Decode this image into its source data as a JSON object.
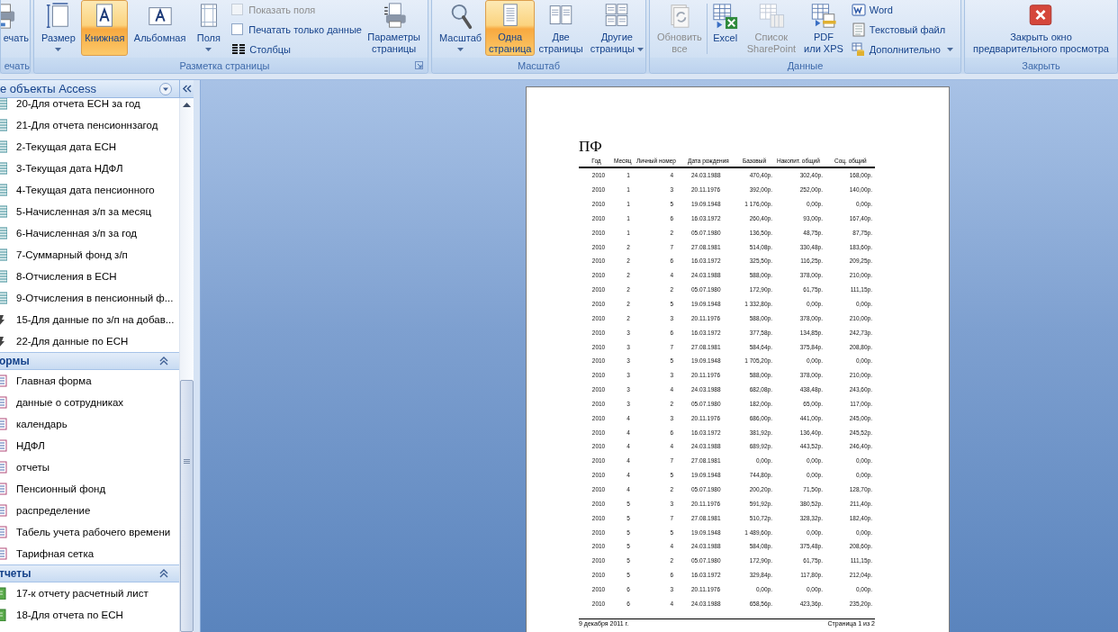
{
  "ribbon": {
    "groups": [
      {
        "label": "ечать",
        "launcher": false,
        "controls": [
          {
            "kind": "large",
            "lines": [
              "ечать"
            ],
            "selected": false,
            "disabled": false,
            "dropdown": false
          }
        ]
      },
      {
        "label": "Разметка страницы",
        "launcher": true,
        "controls": [
          {
            "kind": "large",
            "lines": [
              "Размер"
            ],
            "selected": false,
            "disabled": false,
            "dropdown": true
          },
          {
            "kind": "large",
            "lines": [
              "Книжная"
            ],
            "selected": true,
            "disabled": false,
            "dropdown": false
          },
          {
            "kind": "large",
            "lines": [
              "Альбомная"
            ],
            "selected": false,
            "disabled": false,
            "dropdown": false
          },
          {
            "kind": "large",
            "lines": [
              "Поля"
            ],
            "selected": false,
            "disabled": false,
            "dropdown": true
          },
          {
            "kind": "stack",
            "items": [
              {
                "kind": "checkbox",
                "label": "Показать поля",
                "checked": false,
                "disabled": true
              },
              {
                "kind": "checkbox",
                "label": "Печатать только данные",
                "checked": false,
                "disabled": false
              },
              {
                "kind": "small",
                "label": "Столбцы",
                "disabled": false,
                "dropdown": false
              }
            ]
          },
          {
            "kind": "large",
            "lines": [
              "Параметры",
              "страницы"
            ],
            "selected": false,
            "disabled": false,
            "dropdown": false
          }
        ]
      },
      {
        "label": "Масштаб",
        "launcher": false,
        "controls": [
          {
            "kind": "large",
            "lines": [
              "Масштаб"
            ],
            "selected": false,
            "disabled": false,
            "dropdown": true
          },
          {
            "kind": "large",
            "lines": [
              "Одна",
              "страница"
            ],
            "selected": true,
            "disabled": false,
            "dropdown": false
          },
          {
            "kind": "large",
            "lines": [
              "Две",
              "страницы"
            ],
            "selected": false,
            "disabled": false,
            "dropdown": false
          },
          {
            "kind": "large",
            "lines": [
              "Другие",
              "страницы"
            ],
            "selected": false,
            "disabled": false,
            "dropdown": true
          }
        ]
      },
      {
        "label": "Данные",
        "launcher": false,
        "controls": [
          {
            "kind": "large",
            "lines": [
              "Обновить",
              "все"
            ],
            "selected": false,
            "disabled": true,
            "dropdown": false
          },
          {
            "kind": "separator"
          },
          {
            "kind": "large",
            "lines": [
              "Excel"
            ],
            "selected": false,
            "disabled": false,
            "dropdown": false
          },
          {
            "kind": "large",
            "lines": [
              "Список",
              "SharePoint"
            ],
            "selected": false,
            "disabled": true,
            "dropdown": false
          },
          {
            "kind": "large",
            "lines": [
              "PDF",
              "или XPS"
            ],
            "selected": false,
            "disabled": false,
            "dropdown": false
          },
          {
            "kind": "stack",
            "items": [
              {
                "kind": "small",
                "label": "Word",
                "disabled": false,
                "dropdown": false
              },
              {
                "kind": "small",
                "label": "Текстовый файл",
                "disabled": false,
                "dropdown": false
              },
              {
                "kind": "small",
                "label": "Дополнительно",
                "disabled": false,
                "dropdown": true
              }
            ]
          }
        ]
      },
      {
        "label": "Закрыть",
        "launcher": false,
        "controls": [
          {
            "kind": "large",
            "lines": [
              "Закрыть окно",
              "предварительного просмотра"
            ],
            "selected": false,
            "disabled": false,
            "dropdown": false
          }
        ]
      }
    ]
  },
  "nav": {
    "title": "е объекты Access",
    "sections": [
      {
        "items": [
          {
            "kind": "query",
            "label": "20-Для отчета ЕСН за год"
          },
          {
            "kind": "query",
            "label": "21-Для отчета пенсионнзагод"
          },
          {
            "kind": "query",
            "label": "2-Текущая дата ЕСН"
          },
          {
            "kind": "query",
            "label": "3-Текущая дата НДФЛ"
          },
          {
            "kind": "query",
            "label": "4-Текущая дата пенсионного"
          },
          {
            "kind": "query",
            "label": "5-Начисленная з/п за месяц"
          },
          {
            "kind": "query",
            "label": "6-Начисленная з/п за год"
          },
          {
            "kind": "query",
            "label": "7-Суммарный фонд з/п"
          },
          {
            "kind": "query",
            "label": "8-Отчисления в ЕСН"
          },
          {
            "kind": "query",
            "label": "9-Отчисления в пенсионный ф..."
          },
          {
            "kind": "macro",
            "label": "15-Для данные по з/п на добав..."
          },
          {
            "kind": "macro",
            "label": "22-Для данные по ЕСН"
          }
        ]
      },
      {
        "title": "ормы",
        "items": [
          {
            "kind": "form",
            "label": "Главная форма"
          },
          {
            "kind": "form",
            "label": "данные о сотрудниках"
          },
          {
            "kind": "form",
            "label": "календарь"
          },
          {
            "kind": "form",
            "label": "НДФЛ"
          },
          {
            "kind": "form",
            "label": "отчеты"
          },
          {
            "kind": "form",
            "label": "Пенсионный фонд"
          },
          {
            "kind": "form",
            "label": "распределение"
          },
          {
            "kind": "form",
            "label": "Табель учета рабочего времени"
          },
          {
            "kind": "form",
            "label": "Тарифная сетка"
          }
        ]
      },
      {
        "title": "тчеты",
        "items": [
          {
            "kind": "report",
            "label": "17-к отчету расчетный лист"
          },
          {
            "kind": "report",
            "label": "18-Для отчета по ЕСН"
          }
        ]
      }
    ]
  },
  "report": {
    "title": "ПФ",
    "columns": [
      "Год",
      "Месяц",
      "Личный номер",
      "Дата рождения",
      "Базовый",
      "Накопит. общий",
      "Соц. общий"
    ],
    "rows": [
      [
        "2010",
        "1",
        "4",
        "24.03.1988",
        "470,40р.",
        "302,40р.",
        "168,00р."
      ],
      [
        "2010",
        "1",
        "3",
        "20.11.1976",
        "392,00р.",
        "252,00р.",
        "140,00р."
      ],
      [
        "2010",
        "1",
        "5",
        "19.09.1948",
        "1 176,00р.",
        "0,00р.",
        "0,00р."
      ],
      [
        "2010",
        "1",
        "6",
        "16.03.1972",
        "260,40р.",
        "93,00р.",
        "167,40р."
      ],
      [
        "2010",
        "1",
        "2",
        "05.07.1980",
        "136,50р.",
        "48,75р.",
        "87,75р."
      ],
      [
        "2010",
        "2",
        "7",
        "27.08.1981",
        "514,08р.",
        "330,48р.",
        "183,60р."
      ],
      [
        "2010",
        "2",
        "6",
        "16.03.1972",
        "325,50р.",
        "116,25р.",
        "209,25р."
      ],
      [
        "2010",
        "2",
        "4",
        "24.03.1988",
        "588,00р.",
        "378,00р.",
        "210,00р."
      ],
      [
        "2010",
        "2",
        "2",
        "05.07.1980",
        "172,90р.",
        "61,75р.",
        "111,15р."
      ],
      [
        "2010",
        "2",
        "5",
        "19.09.1948",
        "1 332,80р.",
        "0,00р.",
        "0,00р."
      ],
      [
        "2010",
        "2",
        "3",
        "20.11.1976",
        "588,00р.",
        "378,00р.",
        "210,00р."
      ],
      [
        "2010",
        "3",
        "6",
        "16.03.1972",
        "377,58р.",
        "134,85р.",
        "242,73р."
      ],
      [
        "2010",
        "3",
        "7",
        "27.08.1981",
        "584,64р.",
        "375,84р.",
        "208,80р."
      ],
      [
        "2010",
        "3",
        "5",
        "19.09.1948",
        "1 705,20р.",
        "0,00р.",
        "0,00р."
      ],
      [
        "2010",
        "3",
        "3",
        "20.11.1976",
        "588,00р.",
        "378,00р.",
        "210,00р."
      ],
      [
        "2010",
        "3",
        "4",
        "24.03.1988",
        "682,08р.",
        "438,48р.",
        "243,60р."
      ],
      [
        "2010",
        "3",
        "2",
        "05.07.1980",
        "182,00р.",
        "65,00р.",
        "117,00р."
      ],
      [
        "2010",
        "4",
        "3",
        "20.11.1976",
        "686,00р.",
        "441,00р.",
        "245,00р."
      ],
      [
        "2010",
        "4",
        "6",
        "16.03.1972",
        "381,92р.",
        "136,40р.",
        "245,52р."
      ],
      [
        "2010",
        "4",
        "4",
        "24.03.1988",
        "689,92р.",
        "443,52р.",
        "246,40р."
      ],
      [
        "2010",
        "4",
        "7",
        "27.08.1981",
        "0,00р.",
        "0,00р.",
        "0,00р."
      ],
      [
        "2010",
        "4",
        "5",
        "19.09.1948",
        "744,80р.",
        "0,00р.",
        "0,00р."
      ],
      [
        "2010",
        "4",
        "2",
        "05.07.1980",
        "200,20р.",
        "71,50р.",
        "128,70р."
      ],
      [
        "2010",
        "5",
        "3",
        "20.11.1976",
        "591,92р.",
        "380,52р.",
        "211,40р."
      ],
      [
        "2010",
        "5",
        "7",
        "27.08.1981",
        "510,72р.",
        "328,32р.",
        "182,40р."
      ],
      [
        "2010",
        "5",
        "5",
        "19.09.1948",
        "1 489,60р.",
        "0,00р.",
        "0,00р."
      ],
      [
        "2010",
        "5",
        "4",
        "24.03.1988",
        "584,08р.",
        "375,48р.",
        "208,60р."
      ],
      [
        "2010",
        "5",
        "2",
        "05.07.1980",
        "172,90р.",
        "61,75р.",
        "111,15р."
      ],
      [
        "2010",
        "5",
        "6",
        "16.03.1972",
        "329,84р.",
        "117,80р.",
        "212,04р."
      ],
      [
        "2010",
        "6",
        "3",
        "20.11.1976",
        "0,00р.",
        "0,00р.",
        "0,00р."
      ],
      [
        "2010",
        "6",
        "4",
        "24.03.1988",
        "658,56р.",
        "423,36р.",
        "235,20р."
      ]
    ],
    "footer_date": "9 декабря 2011 г.",
    "footer_page": "Страница 1 из 2"
  }
}
